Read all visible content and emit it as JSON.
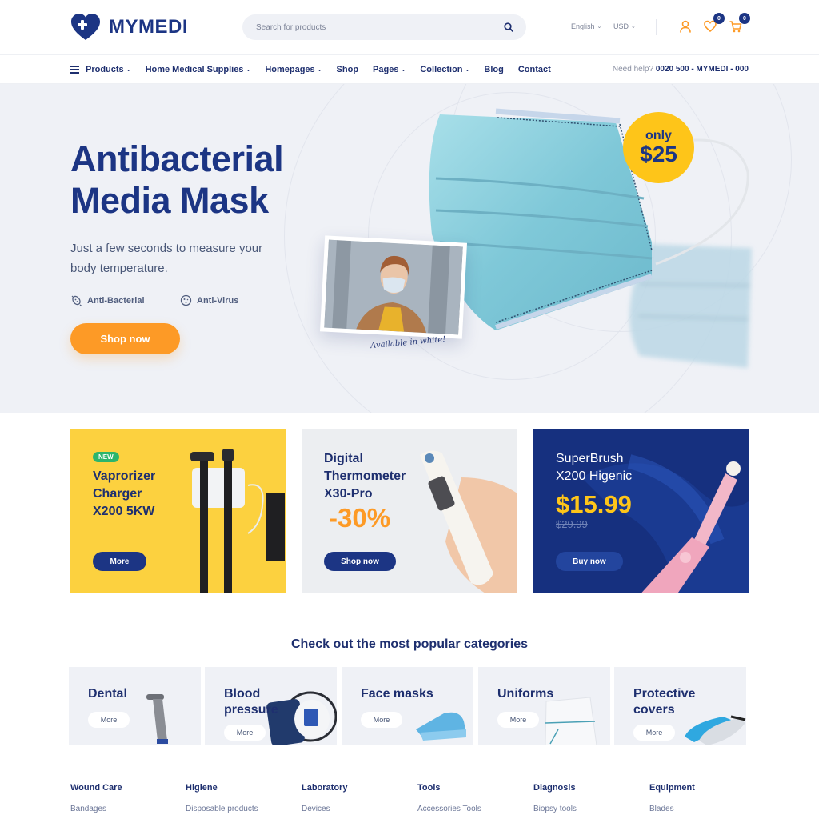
{
  "brand": {
    "name": "MYMEDI",
    "primary_color": "#1c3584",
    "accent_color": "#fd9a26",
    "highlight_color": "#fec519"
  },
  "header": {
    "search_placeholder": "Search for products",
    "language": "English",
    "currency": "USD",
    "wishlist_count": "0",
    "cart_count": "0"
  },
  "nav": {
    "items": [
      {
        "label": "Products",
        "dropdown": true,
        "icon": "menu-icon"
      },
      {
        "label": "Home Medical Supplies",
        "dropdown": true
      },
      {
        "label": "Homepages",
        "dropdown": true
      },
      {
        "label": "Shop",
        "dropdown": false
      },
      {
        "label": "Pages",
        "dropdown": true
      },
      {
        "label": "Collection",
        "dropdown": true
      },
      {
        "label": "Blog",
        "dropdown": false
      },
      {
        "label": "Contact",
        "dropdown": false
      }
    ],
    "help_label": "Need help?",
    "help_phone": "0020 500 - MYMEDI - 000"
  },
  "hero": {
    "title_line1": "Antibacterial",
    "title_line2": "Media Mask",
    "subtitle": "Just a few seconds to measure your body temperature.",
    "features": [
      {
        "label": "Anti-Bacterial",
        "icon": "bacteria-icon"
      },
      {
        "label": "Anti-Virus",
        "icon": "virus-icon"
      }
    ],
    "cta": "Shop now",
    "price_prefix": "only",
    "price": "$25",
    "photo_caption": "Available in white!"
  },
  "promos": [
    {
      "tag": "NEW",
      "title_lines": [
        "Vaprorizer",
        "Charger",
        "X200 5KW"
      ],
      "button": "More"
    },
    {
      "title_lines": [
        "Digital",
        "Thermometer",
        "X30-Pro"
      ],
      "discount": "-30%",
      "button": "Shop now"
    },
    {
      "title_lines": [
        "SuperBrush",
        "X200 Higenic"
      ],
      "price": "$15.99",
      "old_price": "$29.99",
      "button": "Buy now"
    }
  ],
  "categories": {
    "heading": "Check out the most popular categories",
    "items": [
      {
        "title": "Dental",
        "button": "More"
      },
      {
        "title": "Blood pressure",
        "button": "More"
      },
      {
        "title": "Face masks",
        "button": "More"
      },
      {
        "title": "Uniforms",
        "button": "More"
      },
      {
        "title": "Protective covers",
        "button": "More"
      }
    ]
  },
  "footer_links": [
    {
      "heading": "Wound Care",
      "link": "Bandages"
    },
    {
      "heading": "Higiene",
      "link": "Disposable products"
    },
    {
      "heading": "Laboratory",
      "link": "Devices"
    },
    {
      "heading": "Tools",
      "link": "Accessories Tools"
    },
    {
      "heading": "Diagnosis",
      "link": "Biopsy tools"
    },
    {
      "heading": "Equipment",
      "link": "Blades"
    }
  ]
}
